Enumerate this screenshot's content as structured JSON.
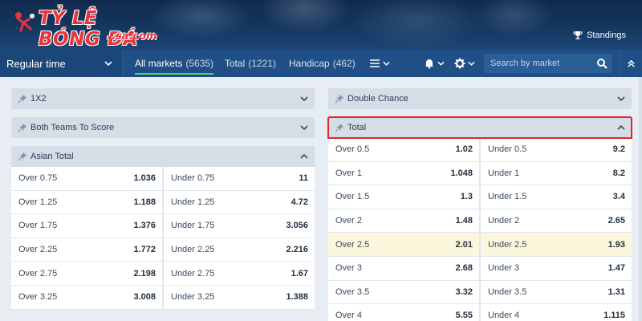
{
  "header": {
    "logo_text": "TỶ LỆ BÓNG ĐÁ",
    "logo_sub": ".sa.com",
    "standings_label": "Standings",
    "standings_icon": "trophy-icon"
  },
  "tabbar": {
    "period_label": "Regular time",
    "tabs": [
      {
        "label": "All markets",
        "count": "(5635)",
        "active": true
      },
      {
        "label": "Total",
        "count": "(1221)",
        "active": false
      },
      {
        "label": "Handicap",
        "count": "(462)",
        "active": false
      }
    ],
    "search_placeholder": "Search by market"
  },
  "left_column": {
    "markets": [
      {
        "title": "1X2",
        "expanded": false
      },
      {
        "title": "Both Teams To Score",
        "expanded": false
      },
      {
        "title": "Asian Total",
        "expanded": true
      }
    ],
    "asian_total_rows": [
      {
        "left_label": "Over 0.75",
        "left_odd": "1.036",
        "right_label": "Under 0.75",
        "right_odd": "11"
      },
      {
        "left_label": "Over 1.25",
        "left_odd": "1.188",
        "right_label": "Under 1.25",
        "right_odd": "4.72"
      },
      {
        "left_label": "Over 1.75",
        "left_odd": "1.376",
        "right_label": "Under 1.75",
        "right_odd": "3.056"
      },
      {
        "left_label": "Over 2.25",
        "left_odd": "1.772",
        "right_label": "Under 2.25",
        "right_odd": "2.216"
      },
      {
        "left_label": "Over 2.75",
        "left_odd": "2.198",
        "right_label": "Under 2.75",
        "right_odd": "1.67"
      },
      {
        "left_label": "Over 3.25",
        "left_odd": "3.008",
        "right_label": "Under 3.25",
        "right_odd": "1.388"
      }
    ]
  },
  "right_column": {
    "markets": [
      {
        "title": "Double Chance",
        "expanded": false
      },
      {
        "title": "Total",
        "expanded": true,
        "highlighted": true
      }
    ],
    "total_rows": [
      {
        "left_label": "Over 0.5",
        "left_odd": "1.02",
        "right_label": "Under 0.5",
        "right_odd": "9.2"
      },
      {
        "left_label": "Over 1",
        "left_odd": "1.048",
        "right_label": "Under 1",
        "right_odd": "8.2"
      },
      {
        "left_label": "Over 1.5",
        "left_odd": "1.3",
        "right_label": "Under 1.5",
        "right_odd": "3.4"
      },
      {
        "left_label": "Over 2",
        "left_odd": "1.48",
        "right_label": "Under 2",
        "right_odd": "2.65"
      },
      {
        "left_label": "Over 2.5",
        "left_odd": "2.01",
        "right_label": "Under 2.5",
        "right_odd": "1.93"
      },
      {
        "left_label": "Over 3",
        "left_odd": "2.68",
        "right_label": "Under 3",
        "right_odd": "1.47"
      },
      {
        "left_label": "Over 3.5",
        "left_odd": "3.32",
        "right_label": "Under 3.5",
        "right_odd": "1.31"
      },
      {
        "left_label": "Over 4",
        "left_odd": "5.55",
        "right_label": "Under 4",
        "right_odd": "1.115"
      }
    ]
  },
  "colors": {
    "header_bg": "#15365f",
    "tabbar_bg": "#1f4f86",
    "active_underline": "#5ad06a",
    "highlight_border": "#e0262b",
    "highlight_row": "#fbf7dd",
    "logo_red": "#e8343b"
  }
}
